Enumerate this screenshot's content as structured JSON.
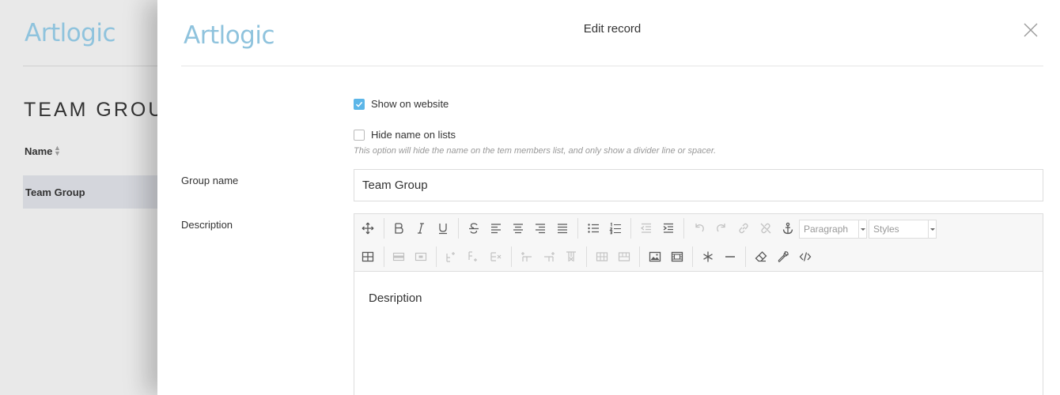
{
  "background": {
    "logo": "Artlogic",
    "page_title": "TEAM GROUPS",
    "column_header": "Name",
    "rows": [
      "Team Group"
    ]
  },
  "modal": {
    "logo": "Artlogic",
    "title": "Edit record",
    "show_on_website": {
      "label": "Show on website",
      "checked": true
    },
    "hide_name": {
      "label": "Hide name on lists",
      "checked": false,
      "hint": "This option will hide the name on the tem members list, and only show a divider line or spacer."
    },
    "group_name": {
      "label": "Group name",
      "value": "Team Group"
    },
    "description": {
      "label": "Description",
      "paragraph_select": "Paragraph",
      "styles_select": "Styles",
      "content": "Desription"
    }
  },
  "colors": {
    "accent": "#5cb6e8",
    "logo": "#8fc3dd",
    "row_highlight": "#d4d6dc"
  }
}
